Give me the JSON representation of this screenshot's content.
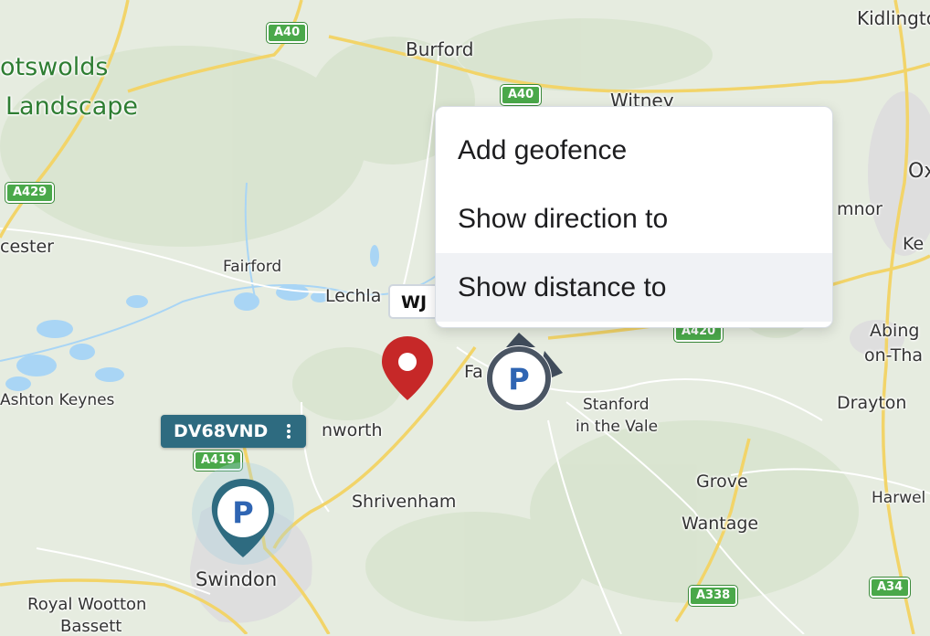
{
  "map": {
    "places": [
      {
        "id": "cotswolds-1",
        "text": "otswolds",
        "kind": "region"
      },
      {
        "id": "cotswolds-2",
        "text": "Landscape",
        "kind": "region"
      },
      {
        "id": "burford",
        "text": "Burford",
        "kind": "town"
      },
      {
        "id": "witney",
        "text": "Witney",
        "kind": "town"
      },
      {
        "id": "kidlington",
        "text": "Kidlingto",
        "kind": "town"
      },
      {
        "id": "oxford",
        "text": "Ox",
        "kind": "town"
      },
      {
        "id": "cumnor",
        "text": "mnor",
        "kind": "village"
      },
      {
        "id": "kennington",
        "text": "Ke",
        "kind": "village"
      },
      {
        "id": "cirencester",
        "text": "cester",
        "kind": "village"
      },
      {
        "id": "fairford",
        "text": "Fairford",
        "kind": "village"
      },
      {
        "id": "lechlade",
        "text": "Lechla",
        "kind": "village"
      },
      {
        "id": "faringdon",
        "text": "Fa",
        "kind": "village"
      },
      {
        "id": "abingdon-1",
        "text": "Abing",
        "kind": "village"
      },
      {
        "id": "abingdon-2",
        "text": "on-Tha",
        "kind": "village"
      },
      {
        "id": "ashton-keynes",
        "text": "Ashton Keynes",
        "kind": "village"
      },
      {
        "id": "highworth",
        "text": "nworth",
        "kind": "village"
      },
      {
        "id": "stanford-1",
        "text": "Stanford",
        "kind": "village"
      },
      {
        "id": "stanford-2",
        "text": "in the Vale",
        "kind": "village"
      },
      {
        "id": "drayton",
        "text": "Drayton",
        "kind": "village"
      },
      {
        "id": "shrivenham",
        "text": "Shrivenham",
        "kind": "village"
      },
      {
        "id": "grove",
        "text": "Grove",
        "kind": "village"
      },
      {
        "id": "harwell",
        "text": "Harwel",
        "kind": "village"
      },
      {
        "id": "wantage",
        "text": "Wantage",
        "kind": "village"
      },
      {
        "id": "swindon",
        "text": "Swindon",
        "kind": "town"
      },
      {
        "id": "royal-wootton-1",
        "text": "Royal Wootton",
        "kind": "village"
      },
      {
        "id": "royal-wootton-2",
        "text": "Bassett",
        "kind": "village"
      }
    ],
    "roads": [
      {
        "id": "a40-west",
        "text": "A40"
      },
      {
        "id": "a40-east",
        "text": "A40"
      },
      {
        "id": "a429",
        "text": "A429"
      },
      {
        "id": "a419",
        "text": "A419"
      },
      {
        "id": "a420",
        "text": "A420"
      },
      {
        "id": "a338",
        "text": "A338"
      },
      {
        "id": "a34",
        "text": "A34"
      }
    ]
  },
  "vehicles": {
    "primary": {
      "registration": "DV68VND",
      "marker_letter": "P"
    },
    "secondary": {
      "registration_partial": "WJ",
      "marker_letter": "P"
    }
  },
  "context_menu": {
    "items": [
      {
        "label": "Add geofence",
        "active": false
      },
      {
        "label": "Show direction to",
        "active": false
      },
      {
        "label": "Show distance to",
        "active": true
      }
    ]
  },
  "colors": {
    "map_background": "#e6ece0",
    "road_yellow": "#f2d469",
    "water": "#a9d5f5",
    "vehicle_label": "#2e6b80",
    "location_pin": "#c62828",
    "region_label": "#2e7d32",
    "road_shield": "#4aa84a"
  }
}
